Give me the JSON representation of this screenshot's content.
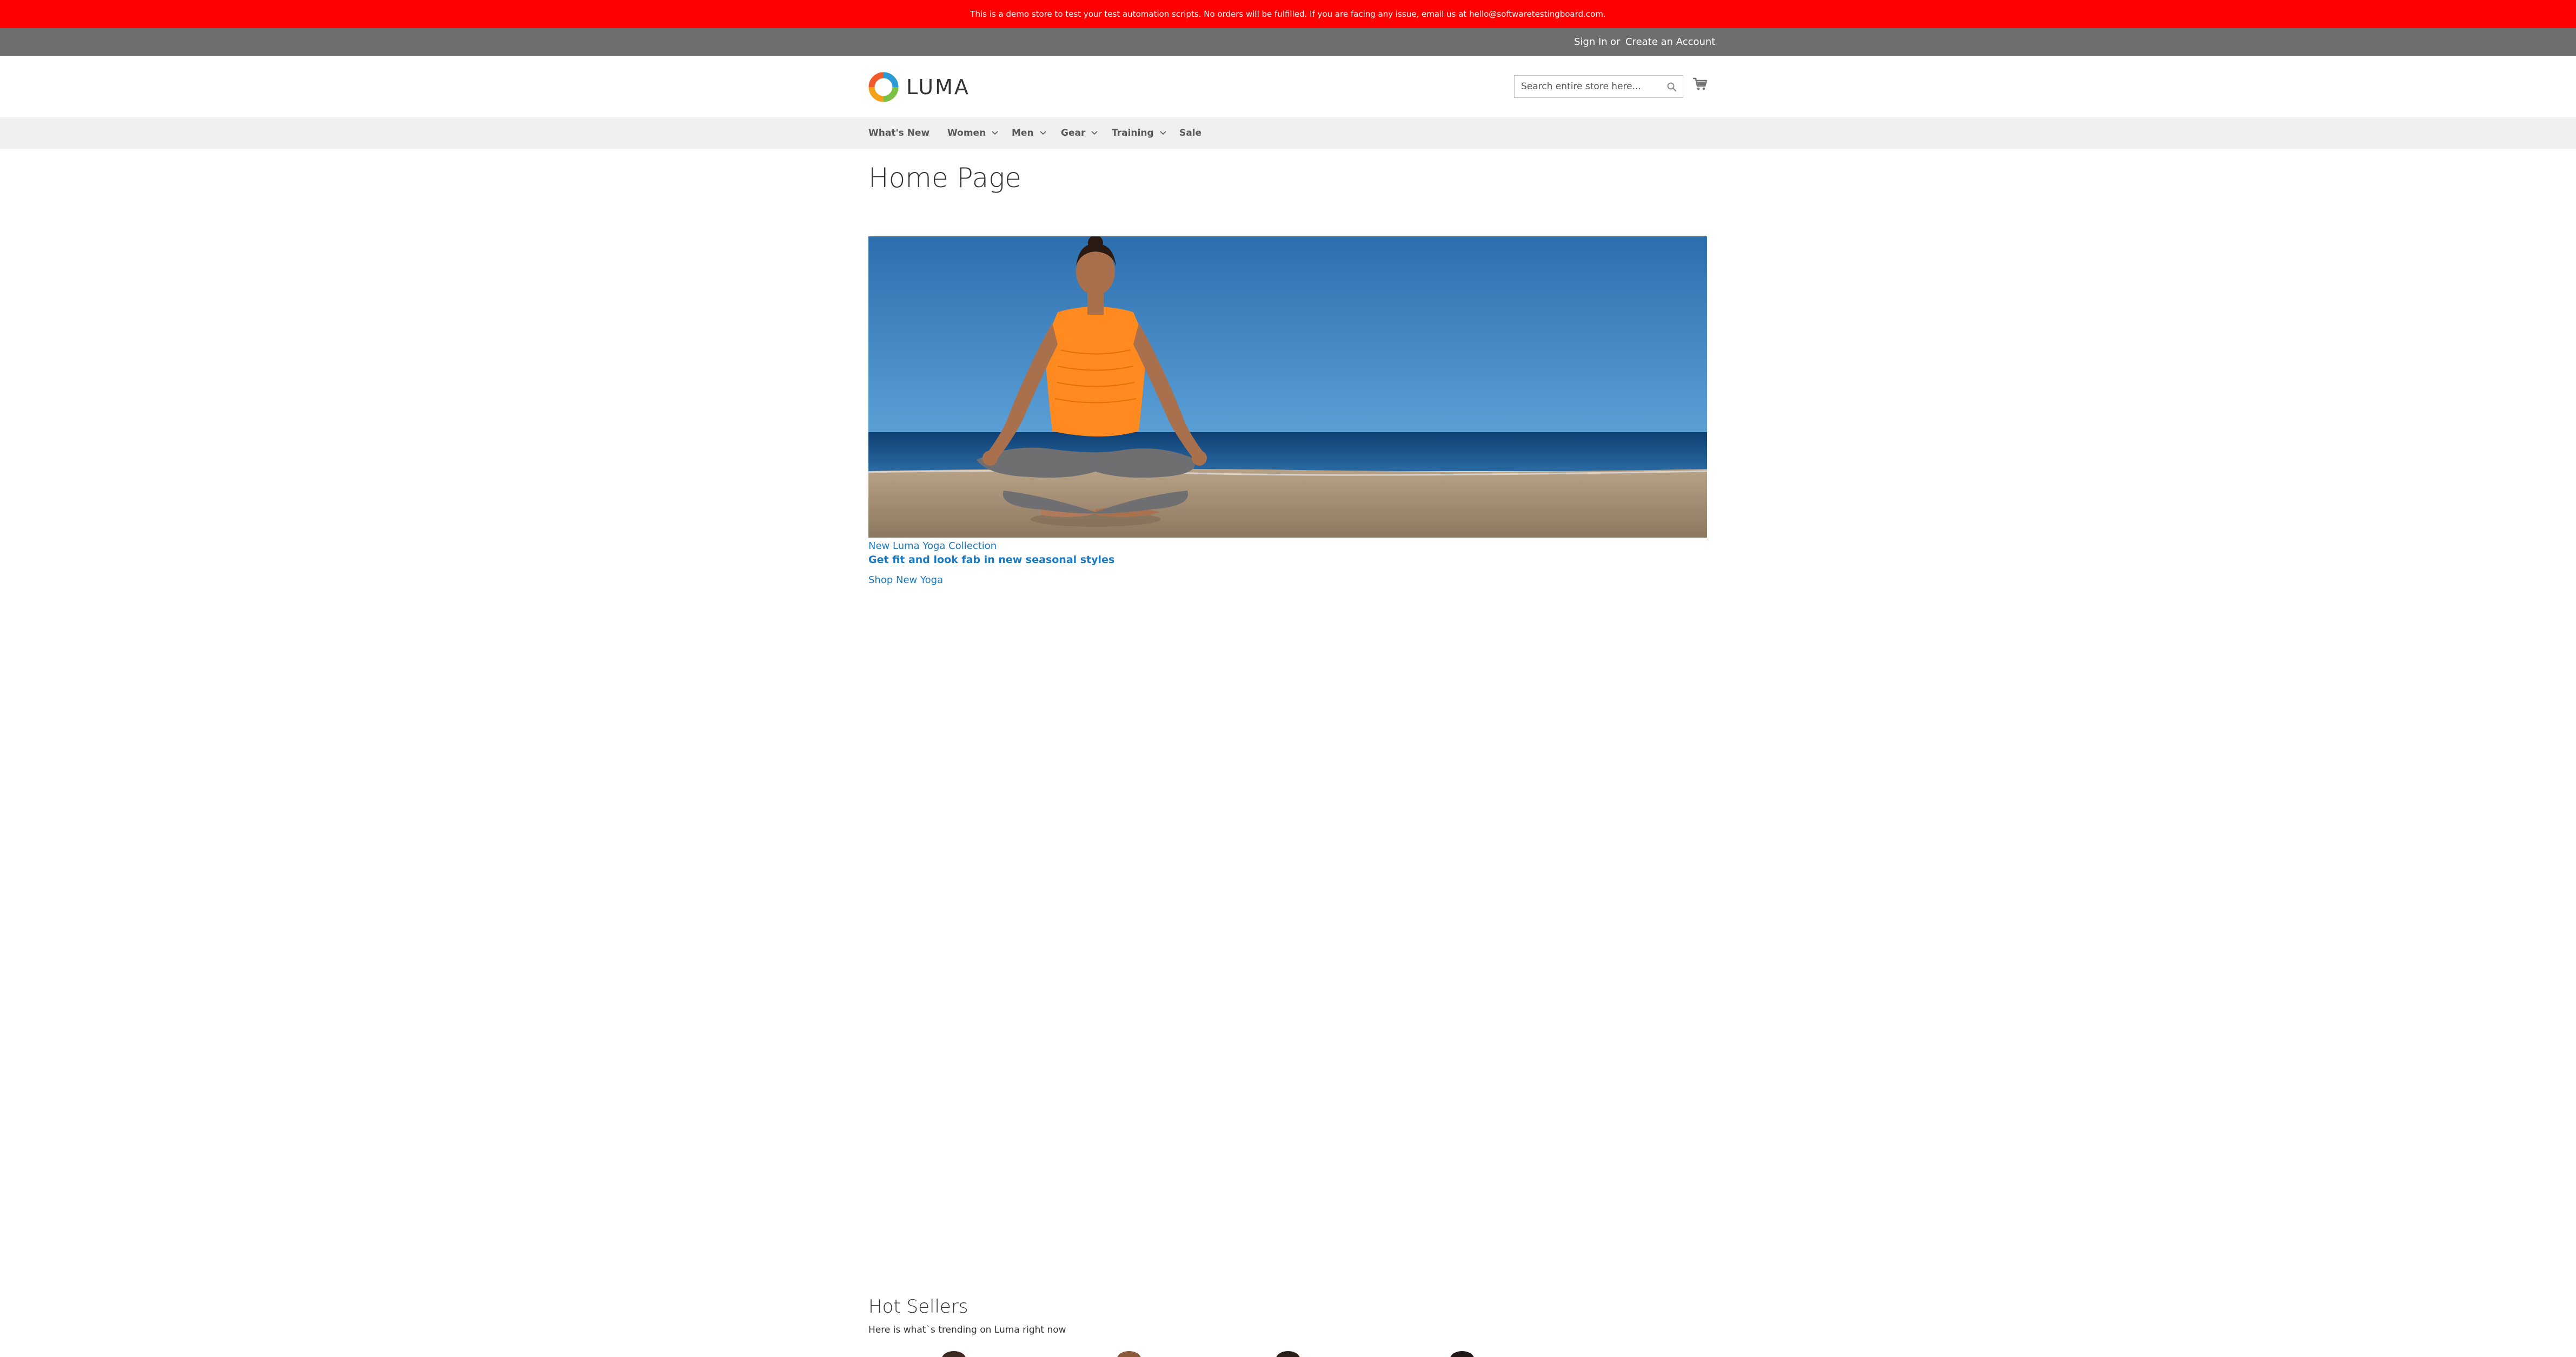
{
  "demo_notice": "This is a demo store to test your test automation scripts. No orders will be fulfilled. If you are facing any issue, email us at hello@softwaretestingboard.com.",
  "top_links": {
    "sign_in": "Sign In",
    "or": "or",
    "create_account": "Create an Account"
  },
  "logo": {
    "text": "LUMA"
  },
  "search": {
    "placeholder": "Search entire store here..."
  },
  "nav": {
    "items": [
      {
        "label": "What's New",
        "has_submenu": false
      },
      {
        "label": "Women",
        "has_submenu": true
      },
      {
        "label": "Men",
        "has_submenu": true
      },
      {
        "label": "Gear",
        "has_submenu": true
      },
      {
        "label": "Training",
        "has_submenu": true
      },
      {
        "label": "Sale",
        "has_submenu": false
      }
    ]
  },
  "page": {
    "title": "Home Page"
  },
  "hero": {
    "subtitle": "New Luma Yoga Collection",
    "title": "Get fit and look fab in new seasonal styles",
    "link": "Shop New Yoga"
  },
  "hot_sellers": {
    "title": "Hot Sellers",
    "subtitle": "Here is what`s trending on Luma right now"
  },
  "colors": {
    "demo_bar": "#ff0000",
    "top_bar": "#6e6e6e",
    "nav_bg": "#f0f0f0",
    "link": "#1979c3"
  }
}
